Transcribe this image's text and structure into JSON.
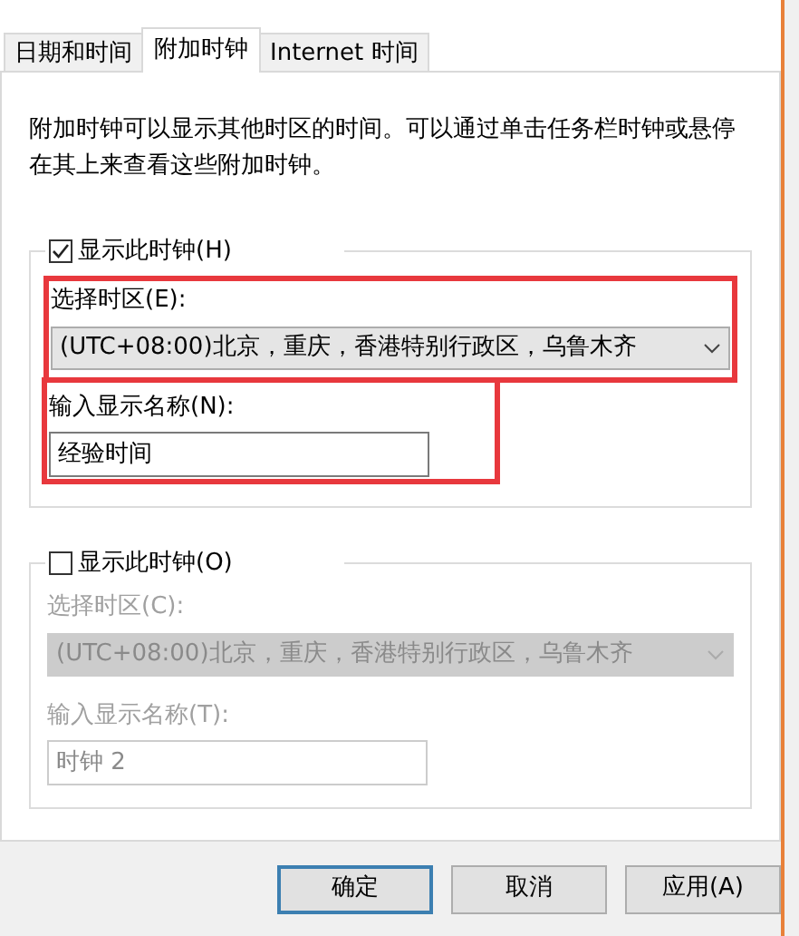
{
  "tabs": [
    {
      "label": "日期和时间",
      "selected": false
    },
    {
      "label": "附加时钟",
      "selected": true
    },
    {
      "label": "Internet 时间",
      "selected": false
    }
  ],
  "description": "附加时钟可以显示其他时区的时间。可以通过单击任务栏时钟或悬停在其上来查看这些附加时钟。",
  "clocks": [
    {
      "checkbox_label": "显示此时钟(H)",
      "checked": true,
      "timezone_label": "选择时区(E):",
      "timezone": "(UTC+08:00)北京，重庆，香港特别行政区，乌鲁木齐",
      "name_label": "输入显示名称(N):",
      "name": "经验时间",
      "highlighted": true
    },
    {
      "checkbox_label": "显示此时钟(O)",
      "checked": false,
      "timezone_label": "选择时区(C):",
      "timezone": "(UTC+08:00)北京，重庆，香港特别行政区，乌鲁木齐",
      "name_label": "输入显示名称(T):",
      "name": "时钟 2",
      "highlighted": false
    }
  ],
  "buttons": [
    {
      "label": "确定",
      "default": true
    },
    {
      "label": "取消",
      "default": false
    },
    {
      "label": "应用(A)",
      "default": false
    }
  ]
}
